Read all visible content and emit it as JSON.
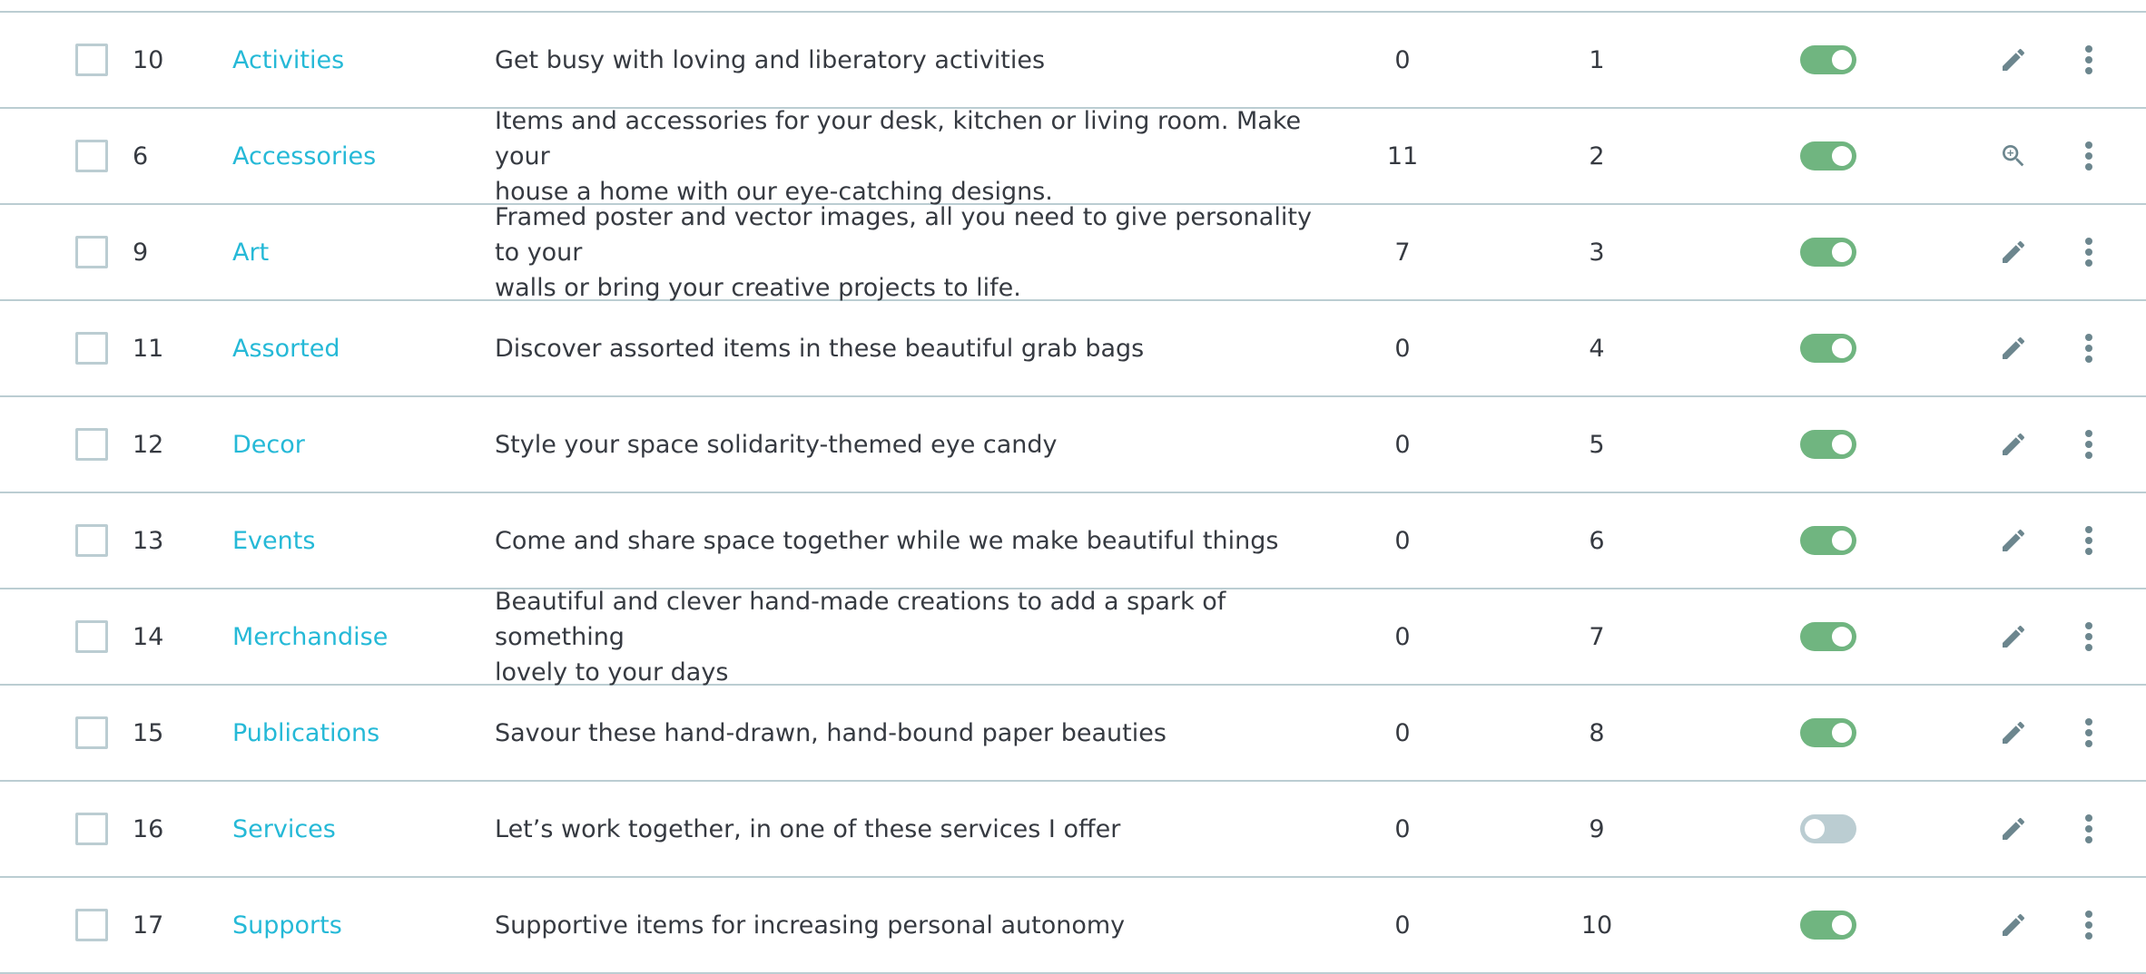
{
  "colors": {
    "link": "#25b9d7",
    "text": "#363a41",
    "border": "#bbcdd2",
    "toggle_on": "#70b580",
    "toggle_off": "#bbcdd2",
    "icon": "#6c868e"
  },
  "rows": [
    {
      "id": "10",
      "name": "Activities",
      "description": [
        "Get busy with loving and liberatory activities"
      ],
      "products": "0",
      "position": "1",
      "enabled": true,
      "action_icon": "edit-icon"
    },
    {
      "id": "6",
      "name": "Accessories",
      "description": [
        "Items and accessories for your desk, kitchen or living room. Make your",
        "house a home with our eye-catching designs."
      ],
      "products": "11",
      "position": "2",
      "enabled": true,
      "action_icon": "zoom-icon"
    },
    {
      "id": "9",
      "name": "Art",
      "description": [
        "Framed poster and vector images, all you need to give personality to your",
        "walls or bring your creative projects to life."
      ],
      "products": "7",
      "position": "3",
      "enabled": true,
      "action_icon": "edit-icon"
    },
    {
      "id": "11",
      "name": "Assorted",
      "description": [
        "Discover assorted items in these beautiful grab bags"
      ],
      "products": "0",
      "position": "4",
      "enabled": true,
      "action_icon": "edit-icon"
    },
    {
      "id": "12",
      "name": "Decor",
      "description": [
        "Style your space solidarity-themed eye candy"
      ],
      "products": "0",
      "position": "5",
      "enabled": true,
      "action_icon": "edit-icon"
    },
    {
      "id": "13",
      "name": "Events",
      "description": [
        "Come and share space together while we make beautiful things"
      ],
      "products": "0",
      "position": "6",
      "enabled": true,
      "action_icon": "edit-icon"
    },
    {
      "id": "14",
      "name": "Merchandise",
      "description": [
        "Beautiful and clever hand-made creations to add a spark of something",
        "lovely to your days"
      ],
      "products": "0",
      "position": "7",
      "enabled": true,
      "action_icon": "edit-icon"
    },
    {
      "id": "15",
      "name": "Publications",
      "description": [
        "Savour these hand-drawn, hand-bound paper beauties"
      ],
      "products": "0",
      "position": "8",
      "enabled": true,
      "action_icon": "edit-icon"
    },
    {
      "id": "16",
      "name": "Services",
      "description": [
        "Let’s work together, in one of these services I offer"
      ],
      "products": "0",
      "position": "9",
      "enabled": false,
      "action_icon": "edit-icon"
    },
    {
      "id": "17",
      "name": "Supports",
      "description": [
        "Supportive items for increasing personal autonomy"
      ],
      "products": "0",
      "position": "10",
      "enabled": true,
      "action_icon": "edit-icon"
    }
  ]
}
